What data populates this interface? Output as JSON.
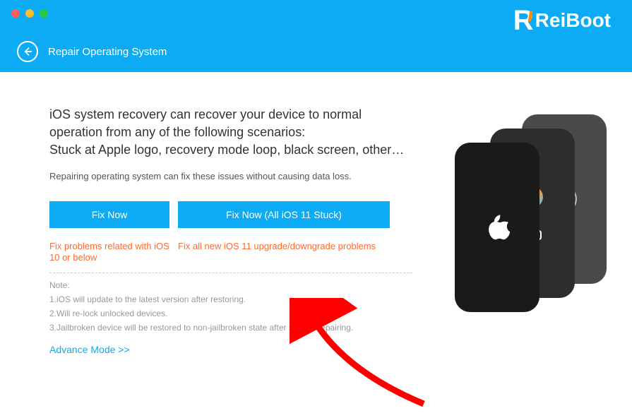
{
  "app": {
    "name": "ReiBoot"
  },
  "subheader": {
    "title": "Repair Operating System"
  },
  "main": {
    "heading_line1": "iOS system recovery can recover your device to normal operation from any of the following scenarios:",
    "heading_line2": "Stuck at Apple logo, recovery mode loop, black screen, other…",
    "subtext": "Repairing operating system can fix these issues without causing data loss.",
    "btn_fix1": "Fix Now",
    "btn_fix2": "Fix Now (All iOS 11 Stuck)",
    "caption1": "Fix problems related with iOS 10 or below",
    "caption2": "Fix all new iOS 11 upgrade/downgrade problems",
    "notes": {
      "label": "Note:",
      "n1": "1.iOS will update to the latest version after restoring.",
      "n2": "2.Will re-lock unlocked devices.",
      "n3": "3.Jailbroken device will be restored to non-jailbroken state after system repairing."
    },
    "advance": "Advance Mode >>"
  }
}
